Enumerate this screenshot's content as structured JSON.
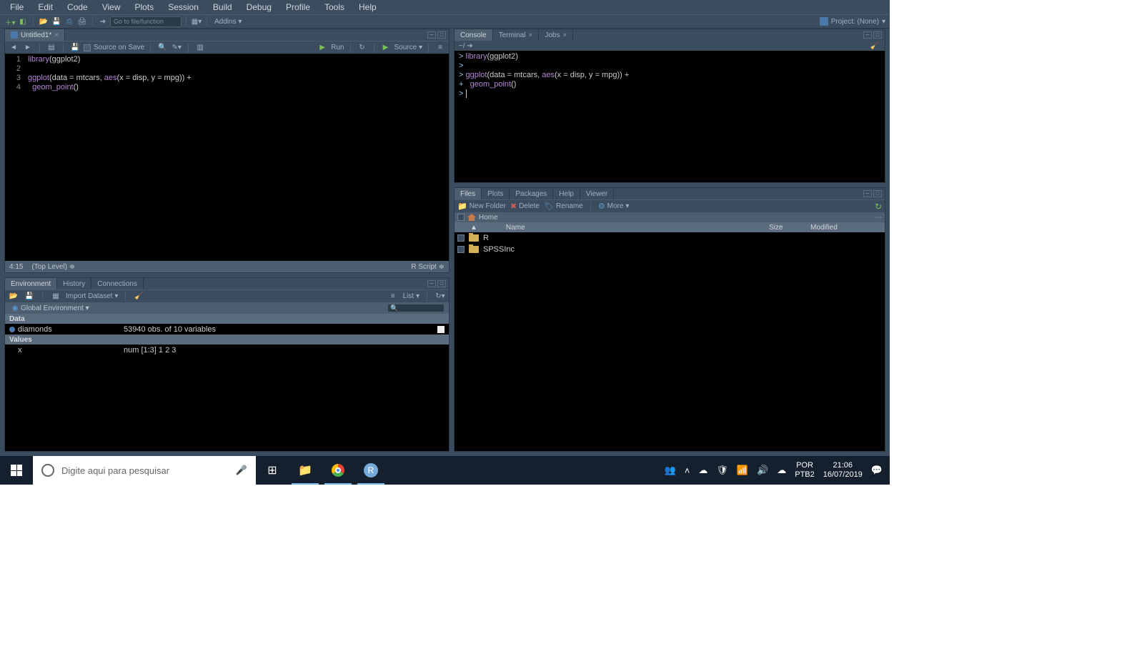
{
  "menu": [
    "File",
    "Edit",
    "Code",
    "View",
    "Plots",
    "Session",
    "Build",
    "Debug",
    "Profile",
    "Tools",
    "Help"
  ],
  "toolbar": {
    "gotofile": "Go to file/function",
    "addins": "Addins",
    "project": "Project: (None)"
  },
  "source": {
    "tab": "Untitled1*",
    "source_on_save": "Source on Save",
    "run": "Run",
    "source_btn": "Source",
    "status_pos": "4:15",
    "status_scope": "(Top Level)",
    "status_type": "R Script",
    "lines": [
      "1",
      "2",
      "3",
      "4"
    ]
  },
  "console": {
    "tabs": [
      "Console",
      "Terminal",
      "Jobs"
    ],
    "path": "~/"
  },
  "env": {
    "tabs": [
      "Environment",
      "History",
      "Connections"
    ],
    "import": "Import Dataset",
    "list": "List",
    "scope": "Global Environment",
    "sect_data": "Data",
    "sect_values": "Values",
    "diamonds": "diamonds",
    "diamonds_desc": "53940 obs. of 10 variables",
    "x_name": "x",
    "x_desc": "num [1:3] 1 2 3"
  },
  "files": {
    "tabs": [
      "Files",
      "Plots",
      "Packages",
      "Help",
      "Viewer"
    ],
    "newfolder": "New Folder",
    "delete": "Delete",
    "rename": "Rename",
    "more": "More",
    "home": "Home",
    "hdr_name": "Name",
    "hdr_size": "Size",
    "hdr_mod": "Modified",
    "rows": [
      {
        "name": "R"
      },
      {
        "name": "SPSSInc"
      }
    ]
  },
  "taskbar": {
    "search": "Digite aqui para pesquisar",
    "lang": "POR",
    "kbd": "PTB2",
    "time": "21:06",
    "date": "16/07/2019"
  }
}
